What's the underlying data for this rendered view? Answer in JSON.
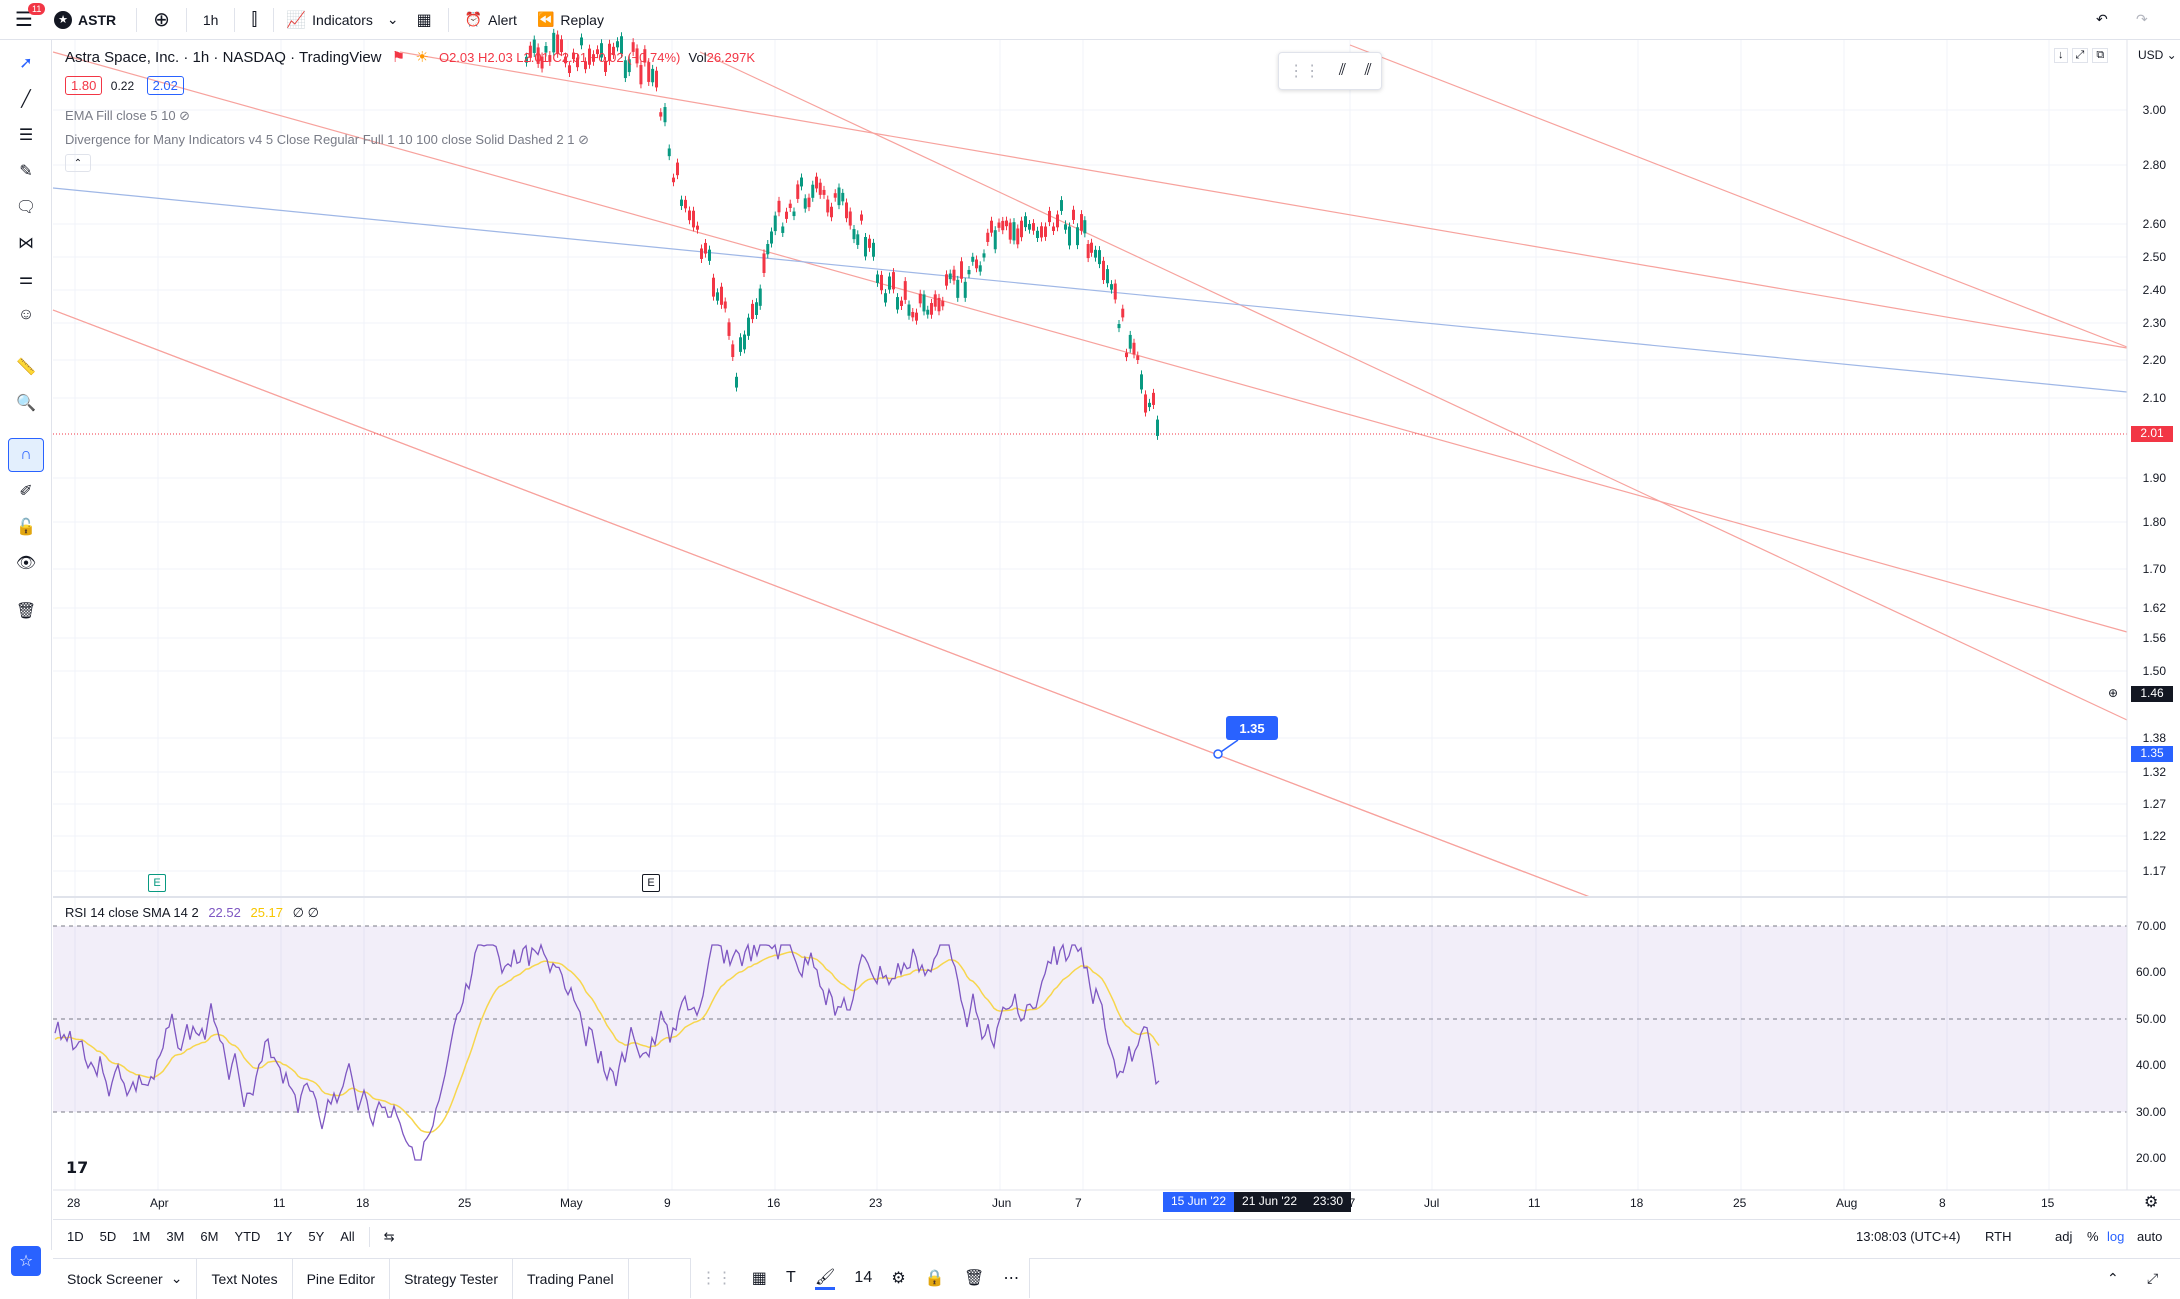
{
  "topbar": {
    "notif_count": "11",
    "symbol": "ASTR",
    "interval": "1h",
    "indicators_label": "Indicators",
    "alert_label": "Alert",
    "replay_label": "Replay"
  },
  "legend": {
    "title": "Astra Space, Inc. · 1h · NASDAQ · TradingView",
    "ohlc": "O2.03 H2.03 L2.01 C2.01 −0.02 (−0.74%)",
    "vol_label": "Vol",
    "vol_value": "26.297K",
    "bid": "1.80",
    "spread": "0.22",
    "ask": "2.02",
    "ind1": "EMA Fill close 5 10",
    "ind2": "Divergence for Many Indicators v4 5 Close Regular Full 1 10 100 close Solid Dashed 2 1"
  },
  "currency": "USD",
  "price_axis": [
    "3.00",
    "2.80",
    "2.60",
    "2.50",
    "2.40",
    "2.30",
    "2.20",
    "2.10",
    "1.90",
    "1.80",
    "1.70",
    "1.62",
    "1.56",
    "1.50",
    "1.38",
    "1.32",
    "1.27",
    "1.22",
    "1.17"
  ],
  "price_tags": {
    "last": "2.01",
    "cross": "1.46",
    "drawn": "1.35"
  },
  "drawn_label": "1.35",
  "rsi": {
    "label": "RSI 14 close SMA 14 2",
    "v1": "22.52",
    "v2": "25.17",
    "v3": "∅ ∅",
    "levels": [
      "70.00",
      "60.00",
      "50.00",
      "40.00",
      "30.00",
      "20.00"
    ]
  },
  "time_axis": [
    "28",
    "Apr",
    "11",
    "18",
    "25",
    "May",
    "9",
    "16",
    "23",
    "Jun",
    "7",
    "27",
    "Jul",
    "11",
    "18",
    "25",
    "Aug",
    "8",
    "15"
  ],
  "time_tags": [
    "15 Jun '22",
    "21 Jun '22",
    "23:30"
  ],
  "events": [
    "E",
    "E"
  ],
  "ranges": [
    "1D",
    "5D",
    "1M",
    "3M",
    "6M",
    "YTD",
    "1Y",
    "5Y",
    "All"
  ],
  "bottom_status": {
    "time": "13:08:03 (UTC+4)",
    "session": "RTH",
    "adj": "adj",
    "pct": "%",
    "log": "log",
    "auto": "auto"
  },
  "footer_tabs": [
    "Stock Screener",
    "Text Notes",
    "Pine Editor",
    "Strategy Tester",
    "Trading Panel"
  ],
  "font_size_value": "14",
  "colors": {
    "up": "#089981",
    "down": "#f23645",
    "accent": "#2962ff",
    "rsi": "#7e57c2",
    "rsi_ma": "#f7d64d",
    "channel": "#f7a29d",
    "ema": "#9fb7e6"
  }
}
